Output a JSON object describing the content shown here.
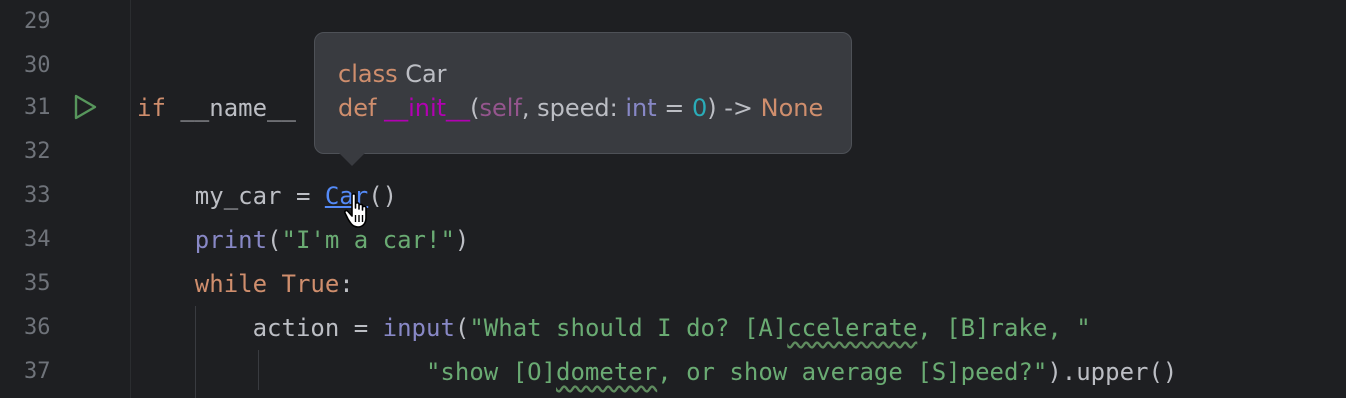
{
  "gutter": {
    "line_numbers": [
      "29",
      "30",
      "31",
      "32",
      "33",
      "34",
      "35",
      "36",
      "37"
    ],
    "run_icon": "run-gutter-icon"
  },
  "code": {
    "line31": {
      "kw_if": "if",
      "rest": " __name__ "
    },
    "line33": {
      "indent": "    ",
      "var": "my_car = ",
      "class_ref": "Car",
      "call": "()"
    },
    "line34": {
      "indent": "    ",
      "fn": "print",
      "open": "(",
      "str": "\"I'm a car!\"",
      "close": ")"
    },
    "line35": {
      "indent": "    ",
      "kw_while": "while",
      "space": " ",
      "kw_true": "True",
      "colon": ":"
    },
    "line36": {
      "indent": "        ",
      "var": "action = ",
      "fn": "input",
      "open": "(",
      "str_a": "\"What should I do? [A]",
      "str_warn": "ccelerate",
      "str_b": ", [B]rake, \""
    },
    "line37": {
      "indent": "                    ",
      "str_a": "\"show [O]",
      "str_warn": "dometer",
      "str_b": ", or show average [S]peed?\"",
      "tail": ").upper()"
    }
  },
  "tooltip": {
    "line1_kw": "class",
    "line1_name": " Car",
    "line2_def": "def",
    "line2_space": " ",
    "line2_init": "__init__",
    "line2_open": "(",
    "line2_self": "self",
    "line2_param": ", speed: ",
    "line2_type": "int",
    "line2_eq": " = ",
    "line2_default": "0",
    "line2_close": ") -> ",
    "line2_ret": "None"
  },
  "cursor": "hand-pointer-icon"
}
